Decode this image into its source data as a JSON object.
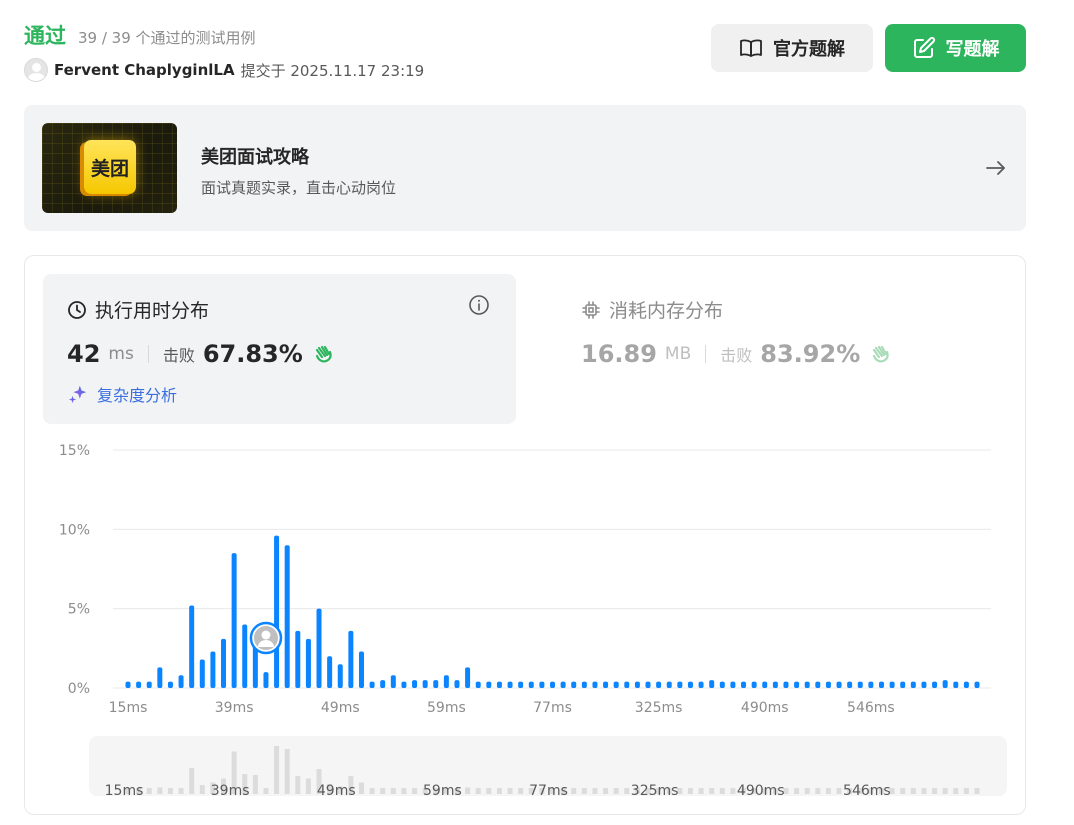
{
  "header": {
    "status": "通过",
    "test_count": "39 / 39 个通过的测试用例",
    "username": "Fervent ChaplyginlLA",
    "submit_text": "提交于 2025.11.17 23:19",
    "official_btn": "官方题解",
    "write_btn": "写题解"
  },
  "banner": {
    "logo_text": "美团",
    "title": "美团面试攻略",
    "subtitle": "面试真题实录，直击心动岗位"
  },
  "runtime": {
    "title": "执行用时分布",
    "value": "42",
    "unit": "ms",
    "beat_label": "击败",
    "beat_value": "67.83%",
    "complexity": "复杂度分析"
  },
  "memory": {
    "title": "消耗内存分布",
    "value": "16.89",
    "unit": "MB",
    "beat_label": "击败",
    "beat_value": "83.92%"
  },
  "colors": {
    "accent_green": "#2db55d",
    "bar_blue": "#0a84ff",
    "link_blue": "#3b6fde"
  },
  "chart_data": {
    "type": "bar",
    "ylabel": "",
    "xlabel": "",
    "y_ticks": [
      "15%",
      "10%",
      "5%",
      "0%"
    ],
    "y_tick_values": [
      15,
      10,
      5,
      0
    ],
    "ylim": [
      0,
      15
    ],
    "x_tick_labels": [
      "15ms",
      "39ms",
      "49ms",
      "59ms",
      "77ms",
      "325ms",
      "490ms",
      "546ms"
    ],
    "x_tick_bar_index": [
      0,
      10,
      20,
      30,
      40,
      50,
      60,
      70
    ],
    "values": [
      0.4,
      0.4,
      0.4,
      1.3,
      0.4,
      0.8,
      5.2,
      1.8,
      2.3,
      3.1,
      8.5,
      4.0,
      3.8,
      1.0,
      9.6,
      9.0,
      3.6,
      3.1,
      5.0,
      2.0,
      1.5,
      3.6,
      2.3,
      0.4,
      0.5,
      0.8,
      0.4,
      0.5,
      0.5,
      0.5,
      0.8,
      0.5,
      1.3,
      0.4,
      0.4,
      0.4,
      0.4,
      0.4,
      0.4,
      0.4,
      0.4,
      0.4,
      0.4,
      0.4,
      0.4,
      0.4,
      0.4,
      0.4,
      0.4,
      0.4,
      0.4,
      0.4,
      0.4,
      0.4,
      0.4,
      0.5,
      0.4,
      0.4,
      0.4,
      0.4,
      0.4,
      0.4,
      0.4,
      0.4,
      0.4,
      0.4,
      0.4,
      0.4,
      0.4,
      0.4,
      0.4,
      0.4,
      0.4,
      0.4,
      0.4,
      0.4,
      0.4,
      0.5,
      0.4,
      0.4,
      0.4
    ],
    "user_bar_index": 13,
    "grid": true
  }
}
